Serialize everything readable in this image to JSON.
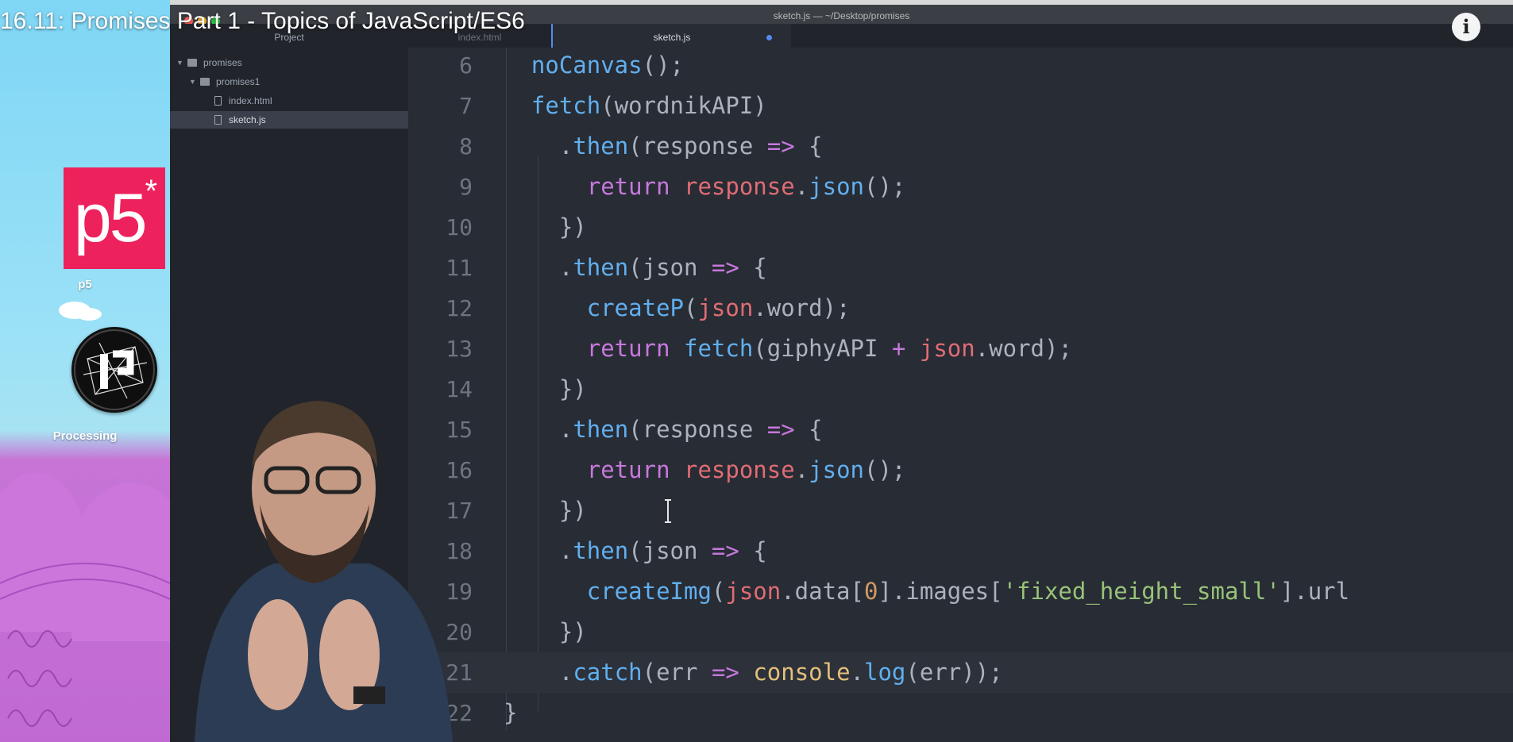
{
  "video": {
    "title": "16.11: Promises Part 1 - Topics of JavaScript/ES6",
    "info_glyph": "i"
  },
  "desktop": {
    "icons": [
      {
        "label": "p5",
        "glyph": "p5",
        "sup": "*",
        "color": "#ed225d"
      },
      {
        "label": "Processing"
      }
    ]
  },
  "window": {
    "title": "sketch.js — ~/Desktop/promises",
    "tabs": [
      {
        "label": "Project",
        "active": false
      },
      {
        "label": "index.html",
        "active": false
      },
      {
        "label": "sketch.js",
        "active": true,
        "modified": true
      }
    ]
  },
  "tree": {
    "items": [
      {
        "label": "promises",
        "type": "folder",
        "depth": 0,
        "expanded": true
      },
      {
        "label": "promises1",
        "type": "folder",
        "depth": 1,
        "expanded": true
      },
      {
        "label": "index.html",
        "type": "file",
        "depth": 2
      },
      {
        "label": "sketch.js",
        "type": "file",
        "depth": 2,
        "selected": true
      }
    ]
  },
  "editor": {
    "lines": [
      {
        "n": "6",
        "tokens": [
          [
            "  ",
            ""
          ],
          [
            "noCanvas",
            "fn"
          ],
          [
            "();",
            ""
          ]
        ]
      },
      {
        "n": "7",
        "tokens": [
          [
            "  ",
            ""
          ],
          [
            "fetch",
            "fn"
          ],
          [
            "(wordnikAPI)",
            ""
          ]
        ]
      },
      {
        "n": "8",
        "tokens": [
          [
            "    .",
            ""
          ],
          [
            "then",
            "fn"
          ],
          [
            "(response ",
            ""
          ],
          [
            "=>",
            "op"
          ],
          [
            " {",
            ""
          ]
        ]
      },
      {
        "n": "9",
        "tokens": [
          [
            "      ",
            ""
          ],
          [
            "return",
            "kw"
          ],
          [
            " ",
            ""
          ],
          [
            "response",
            "var"
          ],
          [
            ".",
            ""
          ],
          [
            "json",
            "fn"
          ],
          [
            "();",
            ""
          ]
        ]
      },
      {
        "n": "10",
        "tokens": [
          [
            "    })",
            ""
          ]
        ]
      },
      {
        "n": "11",
        "tokens": [
          [
            "    .",
            ""
          ],
          [
            "then",
            "fn"
          ],
          [
            "(json ",
            ""
          ],
          [
            "=>",
            "op"
          ],
          [
            " {",
            ""
          ]
        ]
      },
      {
        "n": "12",
        "tokens": [
          [
            "      ",
            ""
          ],
          [
            "createP",
            "fn"
          ],
          [
            "(",
            ""
          ],
          [
            "json",
            "var"
          ],
          [
            ".word);",
            ""
          ]
        ]
      },
      {
        "n": "13",
        "tokens": [
          [
            "      ",
            ""
          ],
          [
            "return",
            "kw"
          ],
          [
            " ",
            ""
          ],
          [
            "fetch",
            "fn"
          ],
          [
            "(giphyAPI ",
            ""
          ],
          [
            "+",
            "op"
          ],
          [
            " ",
            ""
          ],
          [
            "json",
            "var"
          ],
          [
            ".word);",
            ""
          ]
        ]
      },
      {
        "n": "14",
        "tokens": [
          [
            "    })",
            ""
          ]
        ]
      },
      {
        "n": "15",
        "tokens": [
          [
            "    .",
            ""
          ],
          [
            "then",
            "fn"
          ],
          [
            "(response ",
            ""
          ],
          [
            "=>",
            "op"
          ],
          [
            " {",
            ""
          ]
        ]
      },
      {
        "n": "16",
        "tokens": [
          [
            "      ",
            ""
          ],
          [
            "return",
            "kw"
          ],
          [
            " ",
            ""
          ],
          [
            "response",
            "var"
          ],
          [
            ".",
            ""
          ],
          [
            "json",
            "fn"
          ],
          [
            "();",
            ""
          ]
        ]
      },
      {
        "n": "17",
        "tokens": [
          [
            "    })",
            ""
          ]
        ]
      },
      {
        "n": "18",
        "tokens": [
          [
            "    .",
            ""
          ],
          [
            "then",
            "fn"
          ],
          [
            "(json ",
            ""
          ],
          [
            "=>",
            "op"
          ],
          [
            " {",
            ""
          ]
        ]
      },
      {
        "n": "19",
        "tokens": [
          [
            "      ",
            ""
          ],
          [
            "createImg",
            "fn"
          ],
          [
            "(",
            ""
          ],
          [
            "json",
            "var"
          ],
          [
            ".data[",
            ""
          ],
          [
            "0",
            "num"
          ],
          [
            "].images[",
            ""
          ],
          [
            "'fixed_height_small'",
            "str"
          ],
          [
            "].url",
            ""
          ]
        ]
      },
      {
        "n": "20",
        "tokens": [
          [
            "    })",
            ""
          ]
        ]
      },
      {
        "n": "21",
        "tokens": [
          [
            "    .",
            ""
          ],
          [
            "catch",
            "fn"
          ],
          [
            "(err ",
            ""
          ],
          [
            "=>",
            "op"
          ],
          [
            " ",
            ""
          ],
          [
            "console",
            "ob"
          ],
          [
            ".",
            ""
          ],
          [
            "log",
            "fn"
          ],
          [
            "(err));",
            ""
          ]
        ],
        "current": true
      },
      {
        "n": "22",
        "tokens": [
          [
            "}",
            ""
          ]
        ]
      }
    ]
  }
}
